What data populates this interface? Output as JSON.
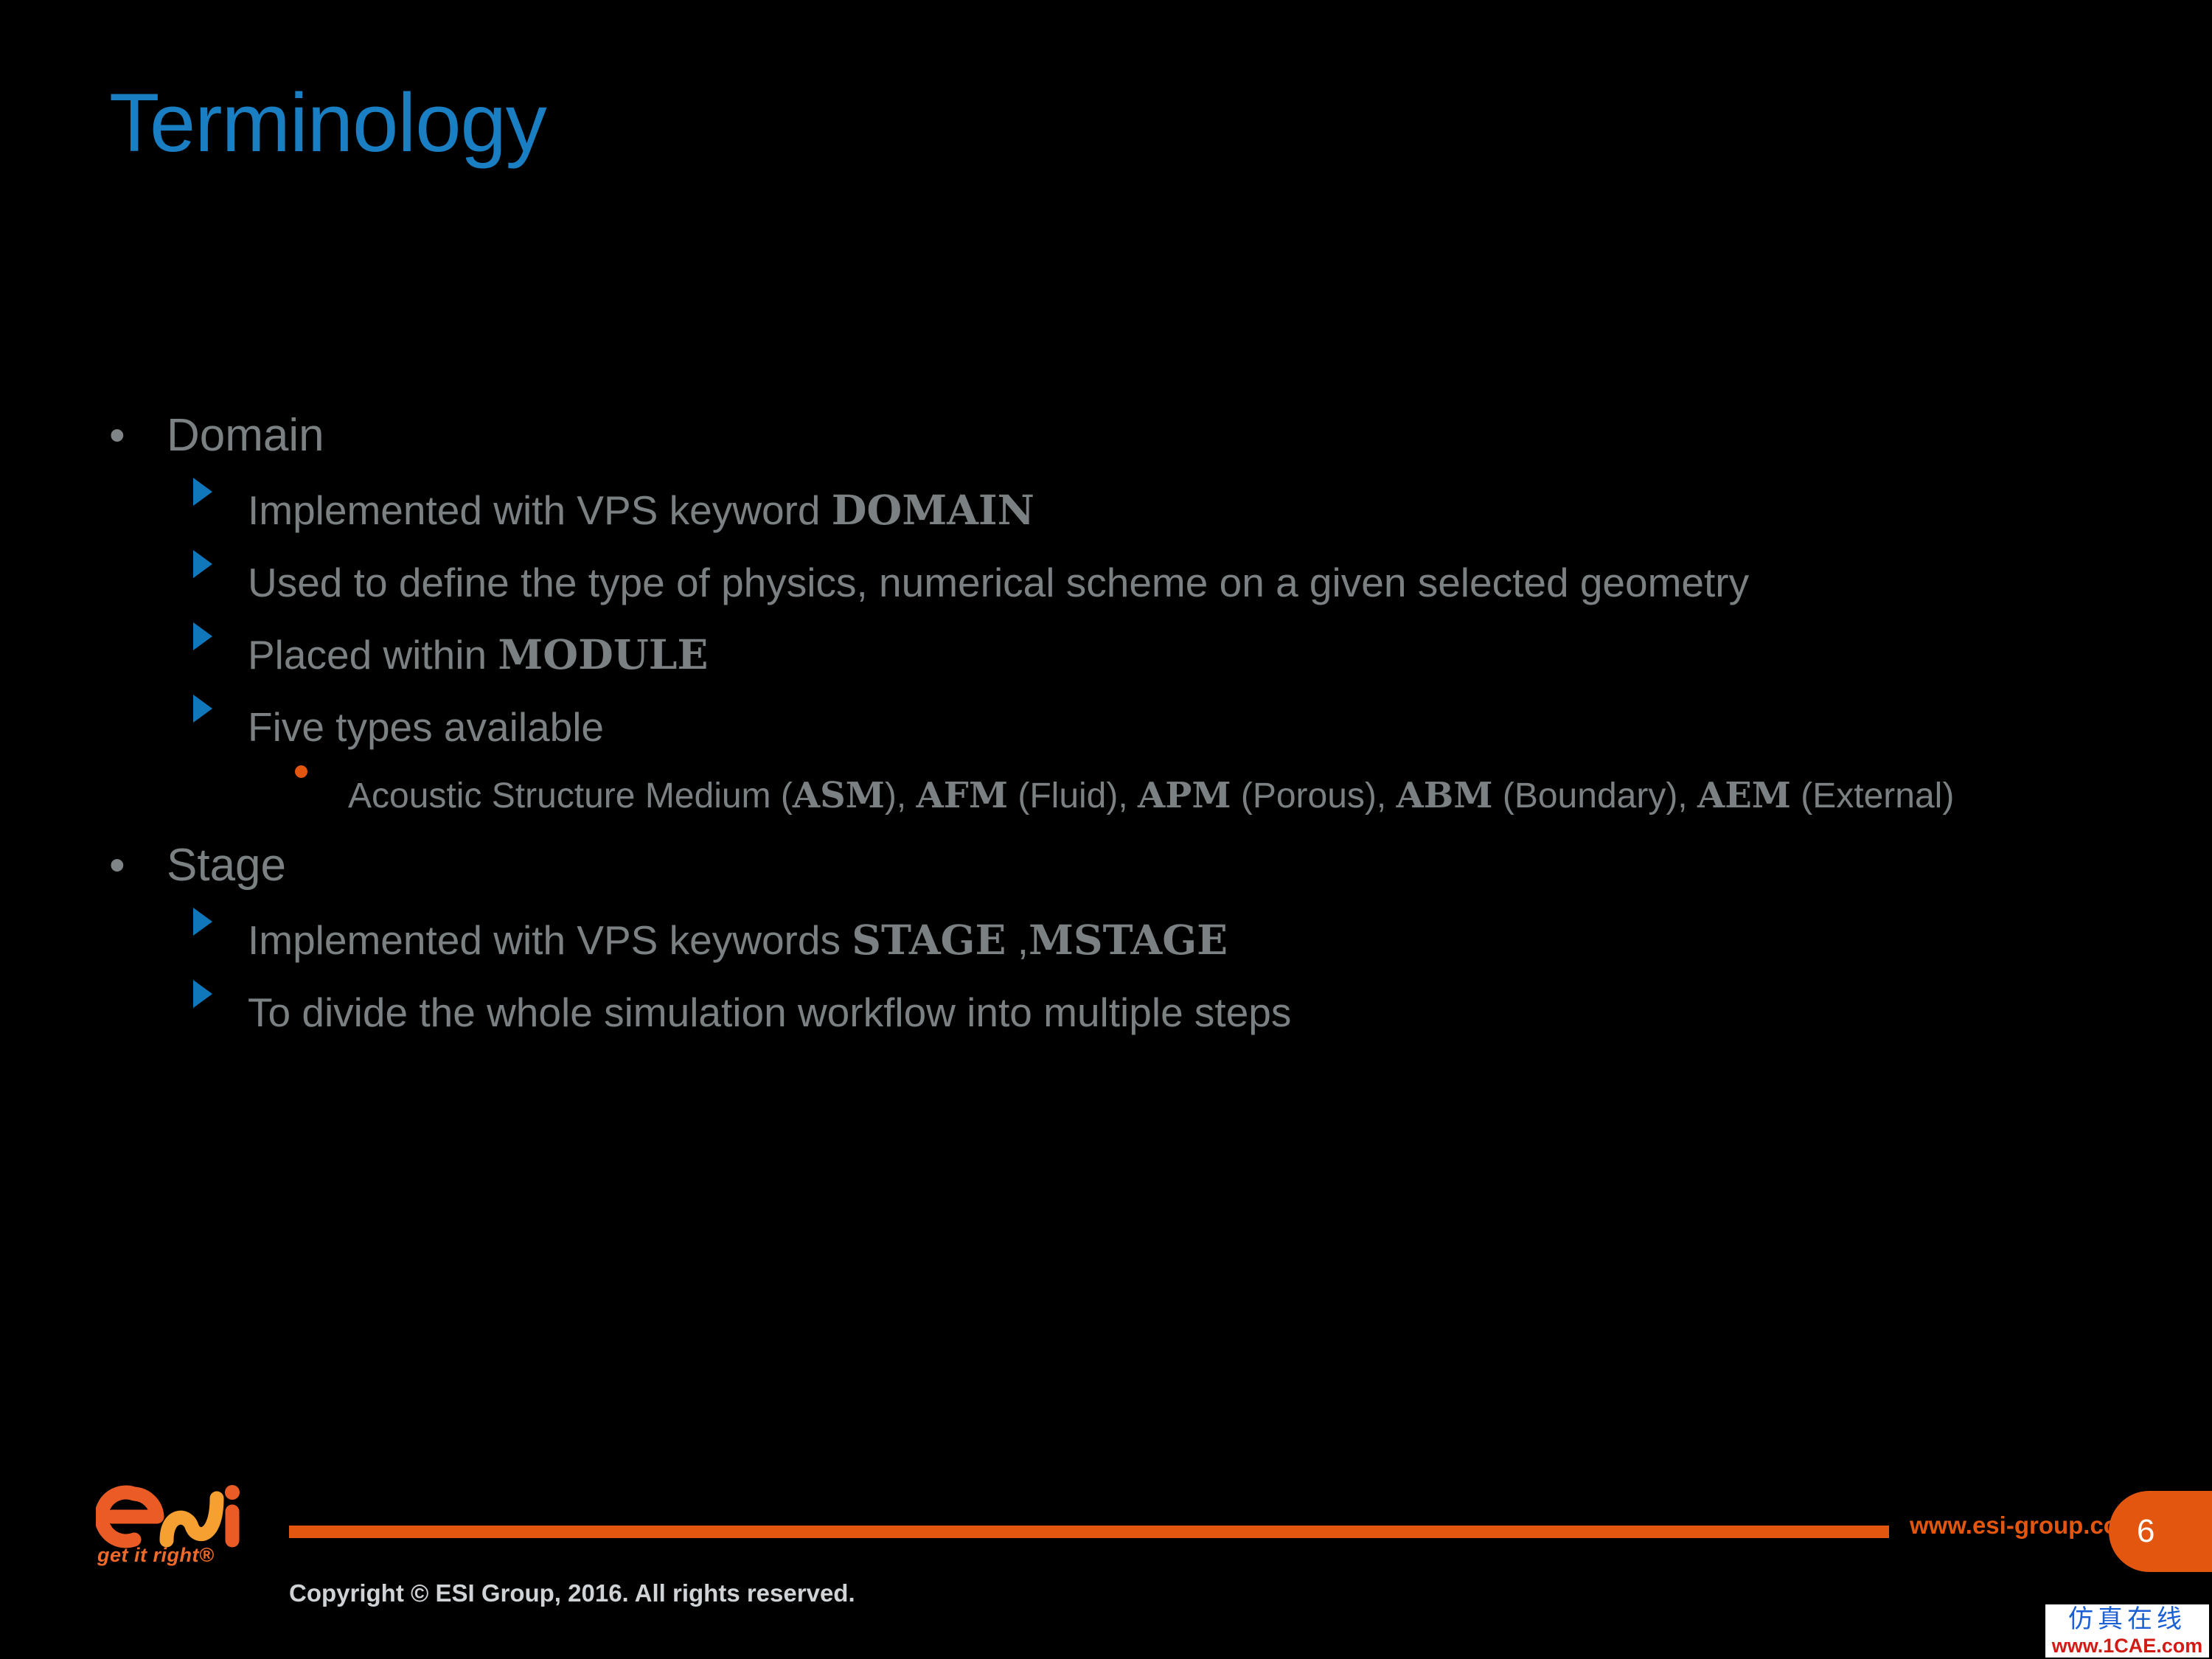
{
  "slide": {
    "title": "Terminology",
    "title_color": "#1a7ec2",
    "background_color": "#000000",
    "page_number": "6"
  },
  "content": {
    "items": [
      {
        "level": 1,
        "bullet": "round-dot-gray",
        "text": "Domain"
      },
      {
        "level": 2,
        "bullet": "triangle-blue",
        "parts": [
          {
            "text": "Implemented with VPS keyword ",
            "style": "normal"
          },
          {
            "text": "DOMAIN",
            "style": "keyword"
          }
        ]
      },
      {
        "level": 2,
        "bullet": "triangle-blue",
        "parts": [
          {
            "text": "Used to define the type of physics, numerical scheme on a given selected geometry",
            "style": "normal"
          }
        ]
      },
      {
        "level": 2,
        "bullet": "triangle-blue",
        "parts": [
          {
            "text": "Placed within ",
            "style": "normal"
          },
          {
            "text": "MODULE",
            "style": "keyword"
          }
        ]
      },
      {
        "level": 2,
        "bullet": "triangle-blue",
        "parts": [
          {
            "text": "Five types available",
            "style": "normal"
          }
        ]
      },
      {
        "level": 3,
        "bullet": "round-dot-orange",
        "parts": [
          {
            "text": "Acoustic Structure Medium (",
            "style": "normal"
          },
          {
            "text": "ASM",
            "style": "keyword"
          },
          {
            "text": "), ",
            "style": "normal"
          },
          {
            "text": "AFM",
            "style": "keyword"
          },
          {
            "text": " (Fluid), ",
            "style": "normal"
          },
          {
            "text": "APM",
            "style": "keyword"
          },
          {
            "text": " (Porous), ",
            "style": "normal"
          },
          {
            "text": "ABM",
            "style": "keyword"
          },
          {
            "text": " (Boundary), ",
            "style": "normal"
          },
          {
            "text": "AEM",
            "style": "keyword"
          },
          {
            "text": " (External)",
            "style": "normal"
          }
        ]
      },
      {
        "level": 1,
        "bullet": "round-dot-gray",
        "text": "Stage"
      },
      {
        "level": 2,
        "bullet": "triangle-blue",
        "parts": [
          {
            "text": "Implemented with VPS keywords ",
            "style": "normal"
          },
          {
            "text": "STAGE",
            "style": "keyword"
          },
          {
            "text": " ,",
            "style": "normal"
          },
          {
            "text": "MSTAGE",
            "style": "keyword"
          }
        ]
      },
      {
        "level": 2,
        "bullet": "triangle-blue",
        "parts": [
          {
            "text": "To divide the whole simulation workflow into multiple steps",
            "style": "normal"
          }
        ]
      }
    ]
  },
  "footer": {
    "logo_text": "esi",
    "logo_tagline": "get it right®",
    "website": "www.esi-group.com",
    "copyright": "Copyright © ESI Group, 2016. All rights reserved.",
    "page_number": "6",
    "accent_color": "#e2560f"
  },
  "watermark": {
    "cn_text": "仿真在线",
    "url_text": "www.1CAE.com"
  }
}
